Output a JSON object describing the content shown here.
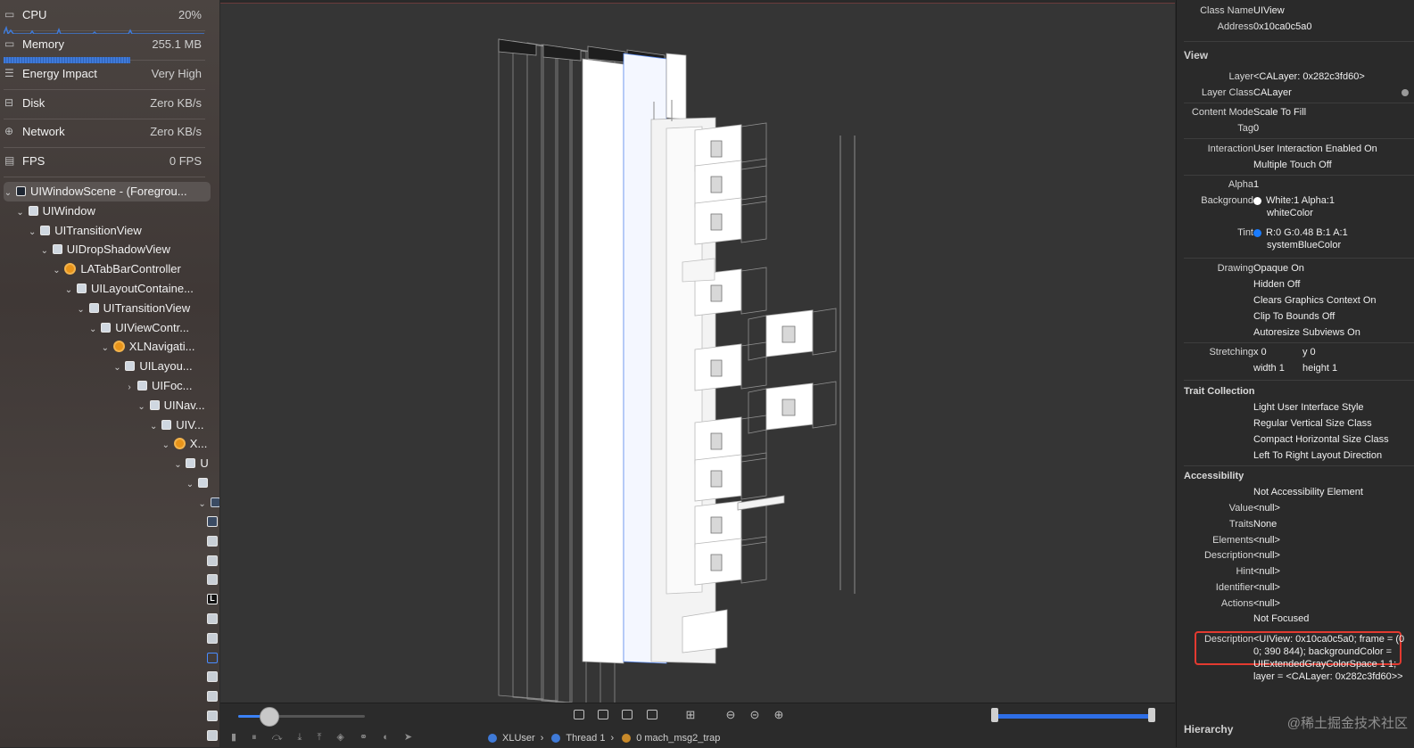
{
  "gauges": [
    {
      "name": "CPU",
      "value": "20%",
      "icon": "cpu-icon"
    },
    {
      "name": "Memory",
      "value": "255.1 MB",
      "icon": "memory-icon"
    },
    {
      "name": "Energy Impact",
      "value": "Very High",
      "icon": "energy-icon"
    },
    {
      "name": "Disk",
      "value": "Zero KB/s",
      "icon": "disk-icon"
    },
    {
      "name": "Network",
      "value": "Zero KB/s",
      "icon": "network-icon"
    },
    {
      "name": "FPS",
      "value": "0 FPS",
      "icon": "fps-icon"
    }
  ],
  "tree": [
    {
      "label": "UIWindowScene - (Foregrou...",
      "icon": "window-scene-icon"
    },
    {
      "label": "UIWindow",
      "icon": "window-icon"
    },
    {
      "label": "UITransitionView",
      "icon": "view-icon"
    },
    {
      "label": "UIDropShadowView",
      "icon": "view-icon"
    },
    {
      "label": "LATabBarController",
      "icon": "controller-icon"
    },
    {
      "label": "UILayoutContaine...",
      "icon": "view-icon"
    },
    {
      "label": "UITransitionView",
      "icon": "view-icon"
    },
    {
      "label": "UIViewContr...",
      "icon": "view-icon"
    },
    {
      "label": "XLNavigati...",
      "icon": "navigation-controller-icon"
    },
    {
      "label": "UILayou...",
      "icon": "view-icon"
    },
    {
      "label": "UIFoc...",
      "icon": "view-icon"
    },
    {
      "label": "UINav...",
      "icon": "view-icon"
    },
    {
      "label": "UIV...",
      "icon": "view-icon"
    },
    {
      "label": "X...",
      "icon": "controller-icon"
    },
    {
      "label": "U",
      "icon": "view-icon"
    },
    {
      "label": "",
      "icon": "view-icon"
    },
    {
      "label": "",
      "icon": "table-icon"
    }
  ],
  "debug_bar": {
    "breadcrumbs": [
      "XLUser",
      "Thread 1",
      "0 mach_msg2_trap"
    ]
  },
  "inspector": {
    "object": {
      "class_name_label": "Class Name",
      "class_name": "UIView",
      "address_label": "Address",
      "address": "0x10ca0c5a0"
    },
    "view_section": "View",
    "layer_label": "Layer",
    "layer": "<CALayer: 0x282c3fd60>",
    "layer_class_label": "Layer Class",
    "layer_class": "CALayer",
    "content_mode_label": "Content Mode",
    "content_mode": "Scale To Fill",
    "tag_label": "Tag",
    "tag": "0",
    "interaction_label": "Interaction",
    "interaction": [
      "User Interaction Enabled On",
      "Multiple Touch Off"
    ],
    "alpha_label": "Alpha",
    "alpha": "1",
    "background_label": "Background",
    "background": "White:1 Alpha:1",
    "background_sub": "whiteColor",
    "background_color": "#ffffff",
    "tint_label": "Tint",
    "tint": "R:0 G:0.48 B:1 A:1",
    "tint_sub": "systemBlueColor",
    "tint_color": "#1a7cff",
    "drawing_label": "Drawing",
    "drawing": [
      "Opaque On",
      "Hidden Off",
      "Clears Graphics Context On",
      "Clip To Bounds Off",
      "Autoresize Subviews On"
    ],
    "stretching_label": "Stretching",
    "stretch_x": "x  0",
    "stretch_y": "y  0",
    "stretch_w": "width  1",
    "stretch_h": "height  1",
    "trait_section": "Trait Collection",
    "traits_list": [
      "Light User Interface Style",
      "Regular Vertical Size Class",
      "Compact Horizontal Size Class",
      "Left To Right Layout Direction"
    ],
    "accessibility_section": "Accessibility",
    "acc_element": "Not Accessibility Element",
    "acc_rows": [
      {
        "k": "Value",
        "v": "<null>"
      },
      {
        "k": "Traits",
        "v": "None"
      },
      {
        "k": "Elements",
        "v": "<null>"
      },
      {
        "k": "Description",
        "v": "<null>"
      },
      {
        "k": "Hint",
        "v": "<null>"
      },
      {
        "k": "Identifier",
        "v": "<null>"
      },
      {
        "k": "Actions",
        "v": "<null>"
      }
    ],
    "focus": "Not Focused",
    "description_label": "Description",
    "description": "<UIView: 0x10ca0c5a0; frame = (0 0; 390 844); backgroundColor = UIExtendedGrayColorSpace 1 1; layer = <CALayer: 0x282c3fd60>>",
    "hierarchy_section": "Hierarchy",
    "watermark": "@稀土掘金技术社区"
  },
  "colors": {
    "accent": "#3b82f6",
    "highlight": "#e33a30"
  }
}
